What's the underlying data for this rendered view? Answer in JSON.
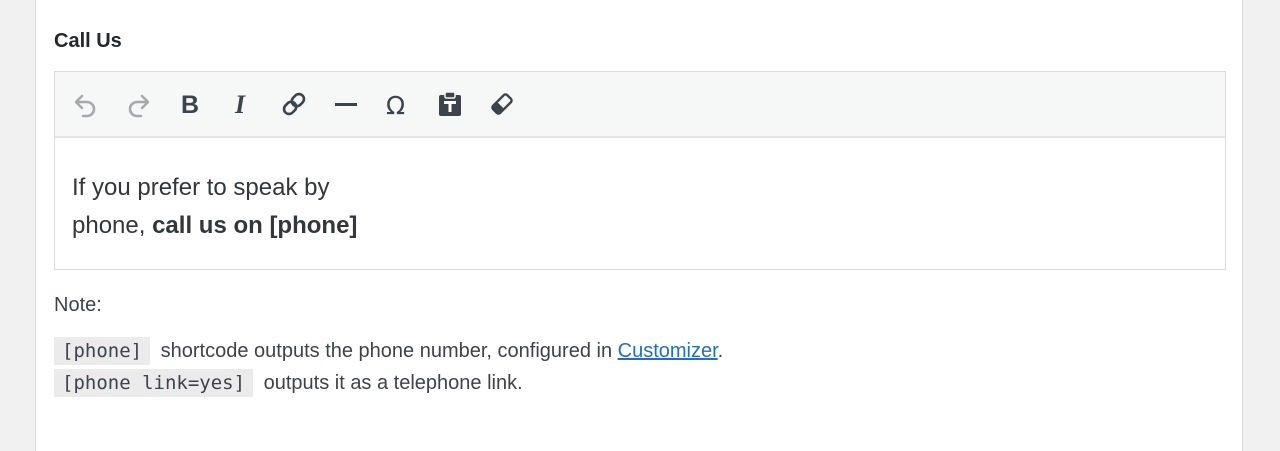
{
  "field": {
    "title": "Call Us"
  },
  "toolbar": {
    "buttons": [
      {
        "name": "undo-icon",
        "label": "Undo"
      },
      {
        "name": "redo-icon",
        "label": "Redo"
      },
      {
        "name": "bold-icon",
        "label": "Bold"
      },
      {
        "name": "italic-icon",
        "label": "Italic"
      },
      {
        "name": "link-icon",
        "label": "Insert/edit link"
      },
      {
        "name": "horizontal-line-icon",
        "label": "Horizontal line"
      },
      {
        "name": "special-character-icon",
        "label": "Special character"
      },
      {
        "name": "paste-as-text-icon",
        "label": "Paste as text"
      },
      {
        "name": "clear-formatting-icon",
        "label": "Clear formatting"
      }
    ]
  },
  "editor": {
    "line1": "If you prefer to speak by",
    "line2_plain": "phone, ",
    "line2_bold": "call us on [phone]"
  },
  "note": {
    "label": "Note:",
    "code1": "[phone]",
    "text1": "shortcode outputs the phone number, configured in ",
    "link": "Customizer",
    "text1_end": ".",
    "code2": "[phone link=yes]",
    "text2": "outputs it as a telephone link."
  },
  "colors": {
    "link": "#2271b1",
    "toolbar_bg": "#f6f7f7",
    "code_bg": "#ebebeb"
  }
}
